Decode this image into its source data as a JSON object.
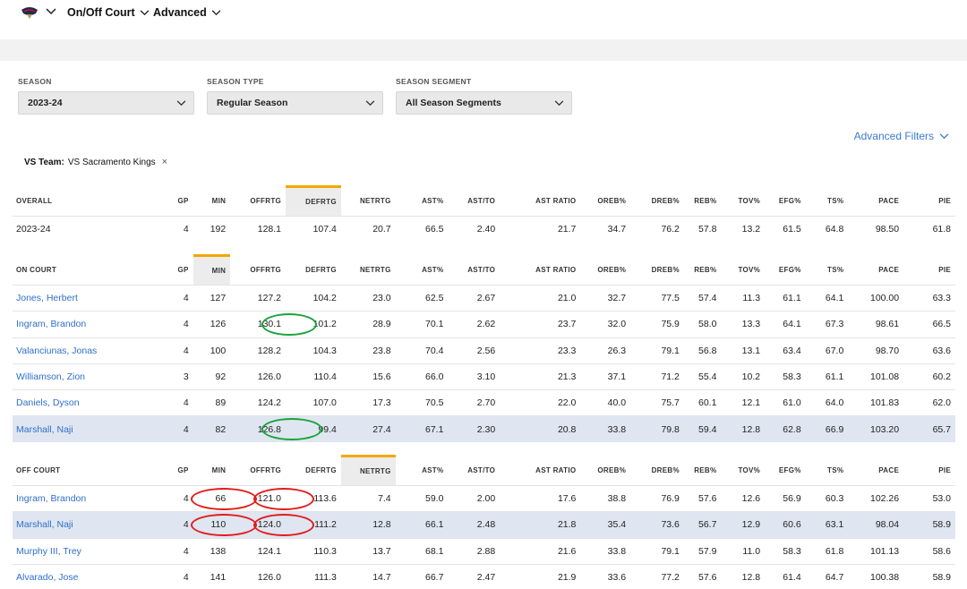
{
  "nav": {
    "items": [
      {
        "label": "On/Off Court"
      },
      {
        "label": "Advanced"
      }
    ]
  },
  "filters": [
    {
      "label": "SEASON",
      "value": "2023-24"
    },
    {
      "label": "SEASON TYPE",
      "value": "Regular Season"
    },
    {
      "label": "SEASON SEGMENT",
      "value": "All Season Segments"
    }
  ],
  "advanced_filters_label": "Advanced Filters",
  "chip": {
    "key": "VS Team:",
    "value": "VS Sacramento Kings",
    "remove": "×"
  },
  "columns": [
    "GP",
    "MIN",
    "OFFRTG",
    "DEFRTG",
    "NETRTG",
    "AST%",
    "AST/TO",
    "AST RATIO",
    "OREB%",
    "DREB%",
    "REB%",
    "TOV%",
    "EFG%",
    "TS%",
    "PACE",
    "PIE"
  ],
  "overall": {
    "heading": "OVERALL",
    "sorted_col": "DEFRTG",
    "rows": [
      {
        "name": "2023-24",
        "vals": [
          "4",
          "192",
          "128.1",
          "107.4",
          "20.7",
          "66.5",
          "2.40",
          "21.7",
          "34.7",
          "76.2",
          "57.8",
          "13.2",
          "61.5",
          "64.8",
          "98.50",
          "61.8"
        ]
      }
    ]
  },
  "on_court": {
    "heading": "ON COURT",
    "sorted_col": "MIN",
    "rows": [
      {
        "name": "Jones, Herbert",
        "vals": [
          "4",
          "127",
          "127.2",
          "104.2",
          "23.0",
          "62.5",
          "2.67",
          "21.0",
          "32.7",
          "77.5",
          "57.4",
          "11.3",
          "61.1",
          "64.1",
          "100.00",
          "63.3"
        ]
      },
      {
        "name": "Ingram, Brandon",
        "vals": [
          "4",
          "126",
          "130.1",
          "101.2",
          "28.9",
          "70.1",
          "2.62",
          "23.7",
          "32.0",
          "75.9",
          "58.0",
          "13.3",
          "64.1",
          "67.3",
          "98.61",
          "66.5"
        ]
      },
      {
        "name": "Valanciunas, Jonas",
        "vals": [
          "4",
          "100",
          "128.2",
          "104.3",
          "23.8",
          "70.4",
          "2.56",
          "23.3",
          "26.3",
          "79.1",
          "56.8",
          "13.1",
          "63.4",
          "67.0",
          "98.70",
          "63.6"
        ]
      },
      {
        "name": "Williamson, Zion",
        "vals": [
          "3",
          "92",
          "126.0",
          "110.4",
          "15.6",
          "66.0",
          "3.10",
          "21.3",
          "37.1",
          "71.2",
          "55.4",
          "10.2",
          "58.3",
          "61.1",
          "101.08",
          "60.2"
        ]
      },
      {
        "name": "Daniels, Dyson",
        "vals": [
          "4",
          "89",
          "124.2",
          "107.0",
          "17.3",
          "70.5",
          "2.70",
          "22.0",
          "40.0",
          "75.7",
          "60.1",
          "12.1",
          "61.0",
          "64.0",
          "101.83",
          "62.0"
        ]
      },
      {
        "name": "Marshall, Naji",
        "vals": [
          "4",
          "82",
          "126.8",
          "99.4",
          "27.4",
          "67.1",
          "2.30",
          "20.8",
          "33.8",
          "79.8",
          "59.4",
          "12.8",
          "62.8",
          "66.9",
          "103.20",
          "65.7"
        ]
      }
    ]
  },
  "off_court": {
    "heading": "OFF COURT",
    "sorted_col": "NETRTG",
    "rows": [
      {
        "name": "Ingram, Brandon",
        "vals": [
          "4",
          "66",
          "121.0",
          "113.6",
          "7.4",
          "59.0",
          "2.00",
          "17.6",
          "38.8",
          "76.9",
          "57.6",
          "12.6",
          "56.9",
          "60.3",
          "102.26",
          "53.0"
        ]
      },
      {
        "name": "Marshall, Naji",
        "vals": [
          "4",
          "110",
          "124.0",
          "111.2",
          "12.8",
          "66.1",
          "2.48",
          "21.8",
          "35.4",
          "73.6",
          "56.7",
          "12.9",
          "60.6",
          "63.1",
          "98.04",
          "58.9"
        ]
      },
      {
        "name": "Murphy III, Trey",
        "vals": [
          "4",
          "138",
          "124.1",
          "110.3",
          "13.7",
          "68.1",
          "2.88",
          "21.6",
          "33.8",
          "79.1",
          "57.9",
          "11.0",
          "58.3",
          "61.8",
          "101.13",
          "58.6"
        ]
      },
      {
        "name": "Alvarado, Jose",
        "vals": [
          "4",
          "141",
          "126.0",
          "111.3",
          "14.7",
          "66.7",
          "2.47",
          "21.9",
          "33.6",
          "77.2",
          "57.6",
          "12.8",
          "61.4",
          "64.7",
          "100.38",
          "58.9"
        ]
      }
    ]
  },
  "colors": {
    "link": "#2f6fc9",
    "sort_accent": "#f2a800",
    "highlight_row": "#dfe6f1",
    "circle_green": "#19a33b",
    "circle_red": "#e11d1d"
  }
}
